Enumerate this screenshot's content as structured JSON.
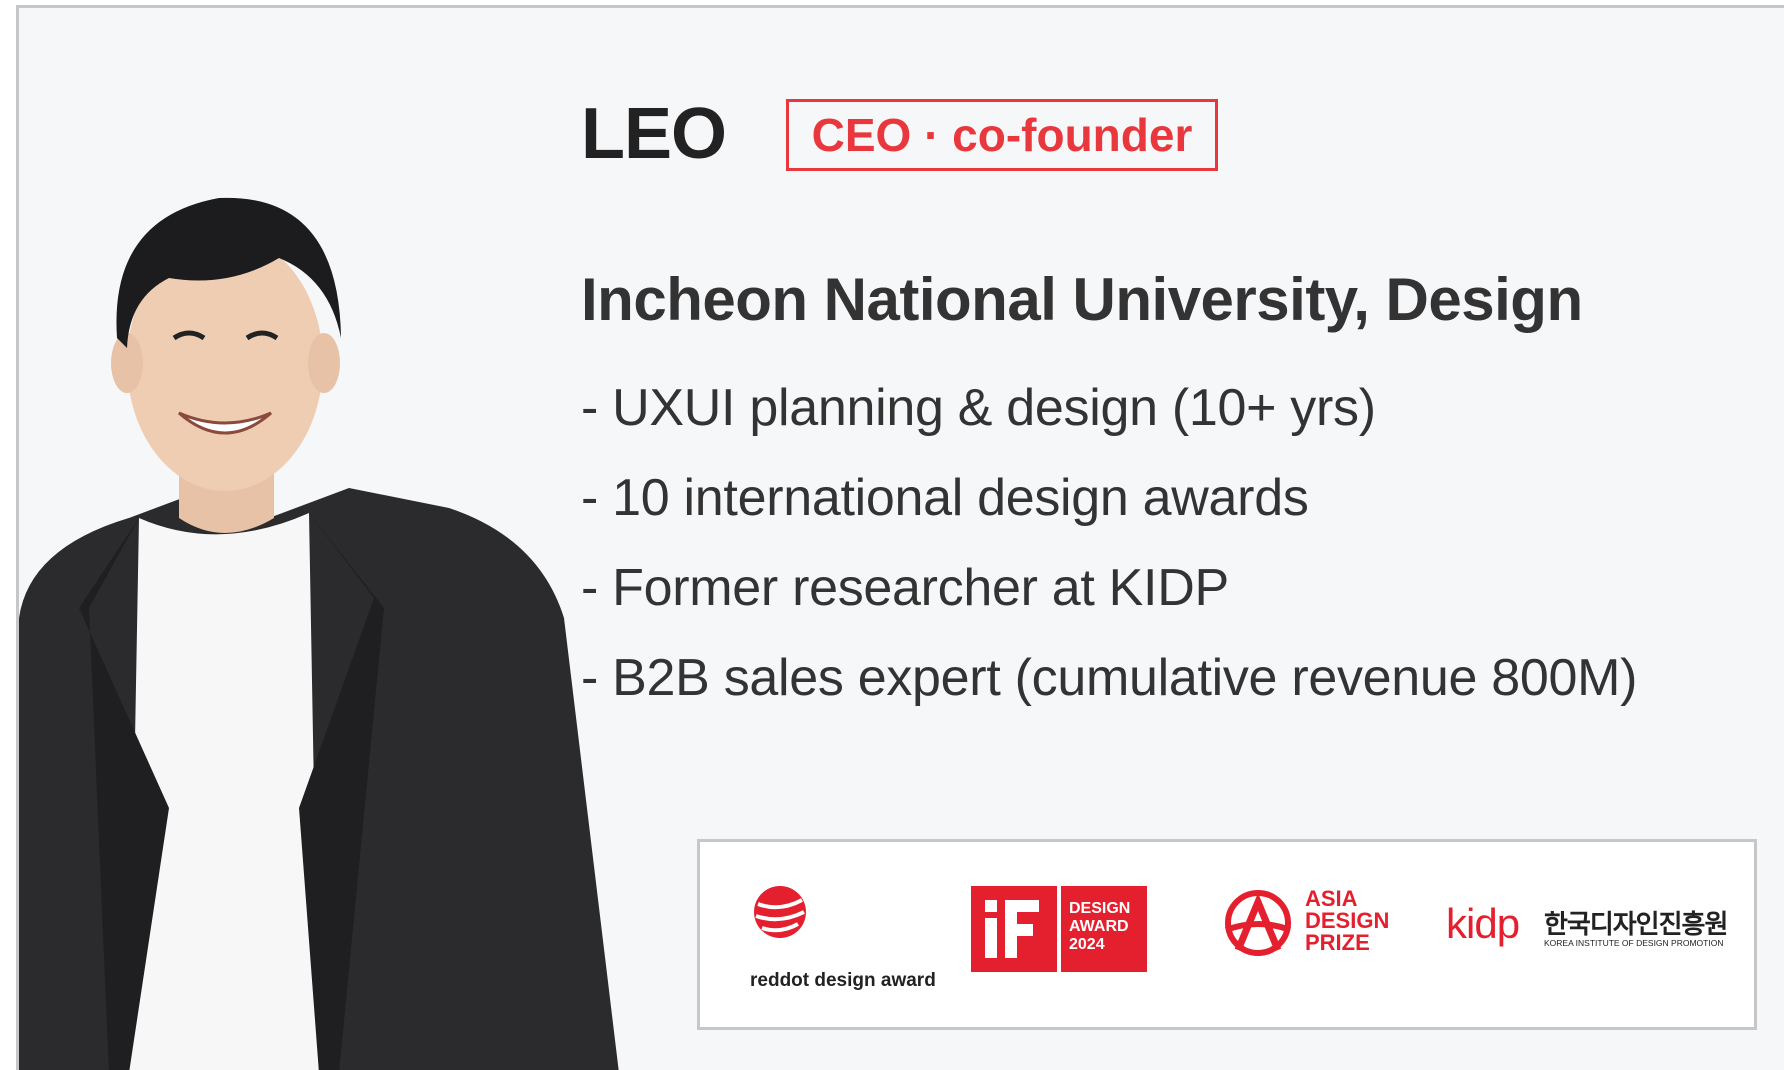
{
  "profile": {
    "name": "LEO",
    "role": "CEO · co-founder",
    "education": "Incheon National University, Design",
    "highlights": [
      "- UXUI planning & design (10+ yrs)",
      "- 10 international design awards",
      "- Former researcher at KIDP",
      "- B2B sales expert (cumulative revenue 800M)"
    ]
  },
  "awards": {
    "reddot": "reddot design award",
    "if_lines": [
      "DESIGN",
      "AWARD",
      "2024"
    ],
    "asia_lines": [
      "ASIA",
      "DESIGN",
      "PRIZE"
    ],
    "kidp_logo": "kidp",
    "kidp_korean": "한국디자인진흥원",
    "kidp_english": "KOREA INSTITUTE OF DESIGN PROMOTION"
  },
  "colors": {
    "accent": "#e8383d",
    "text": "#333333",
    "background": "#f6f7f9"
  }
}
